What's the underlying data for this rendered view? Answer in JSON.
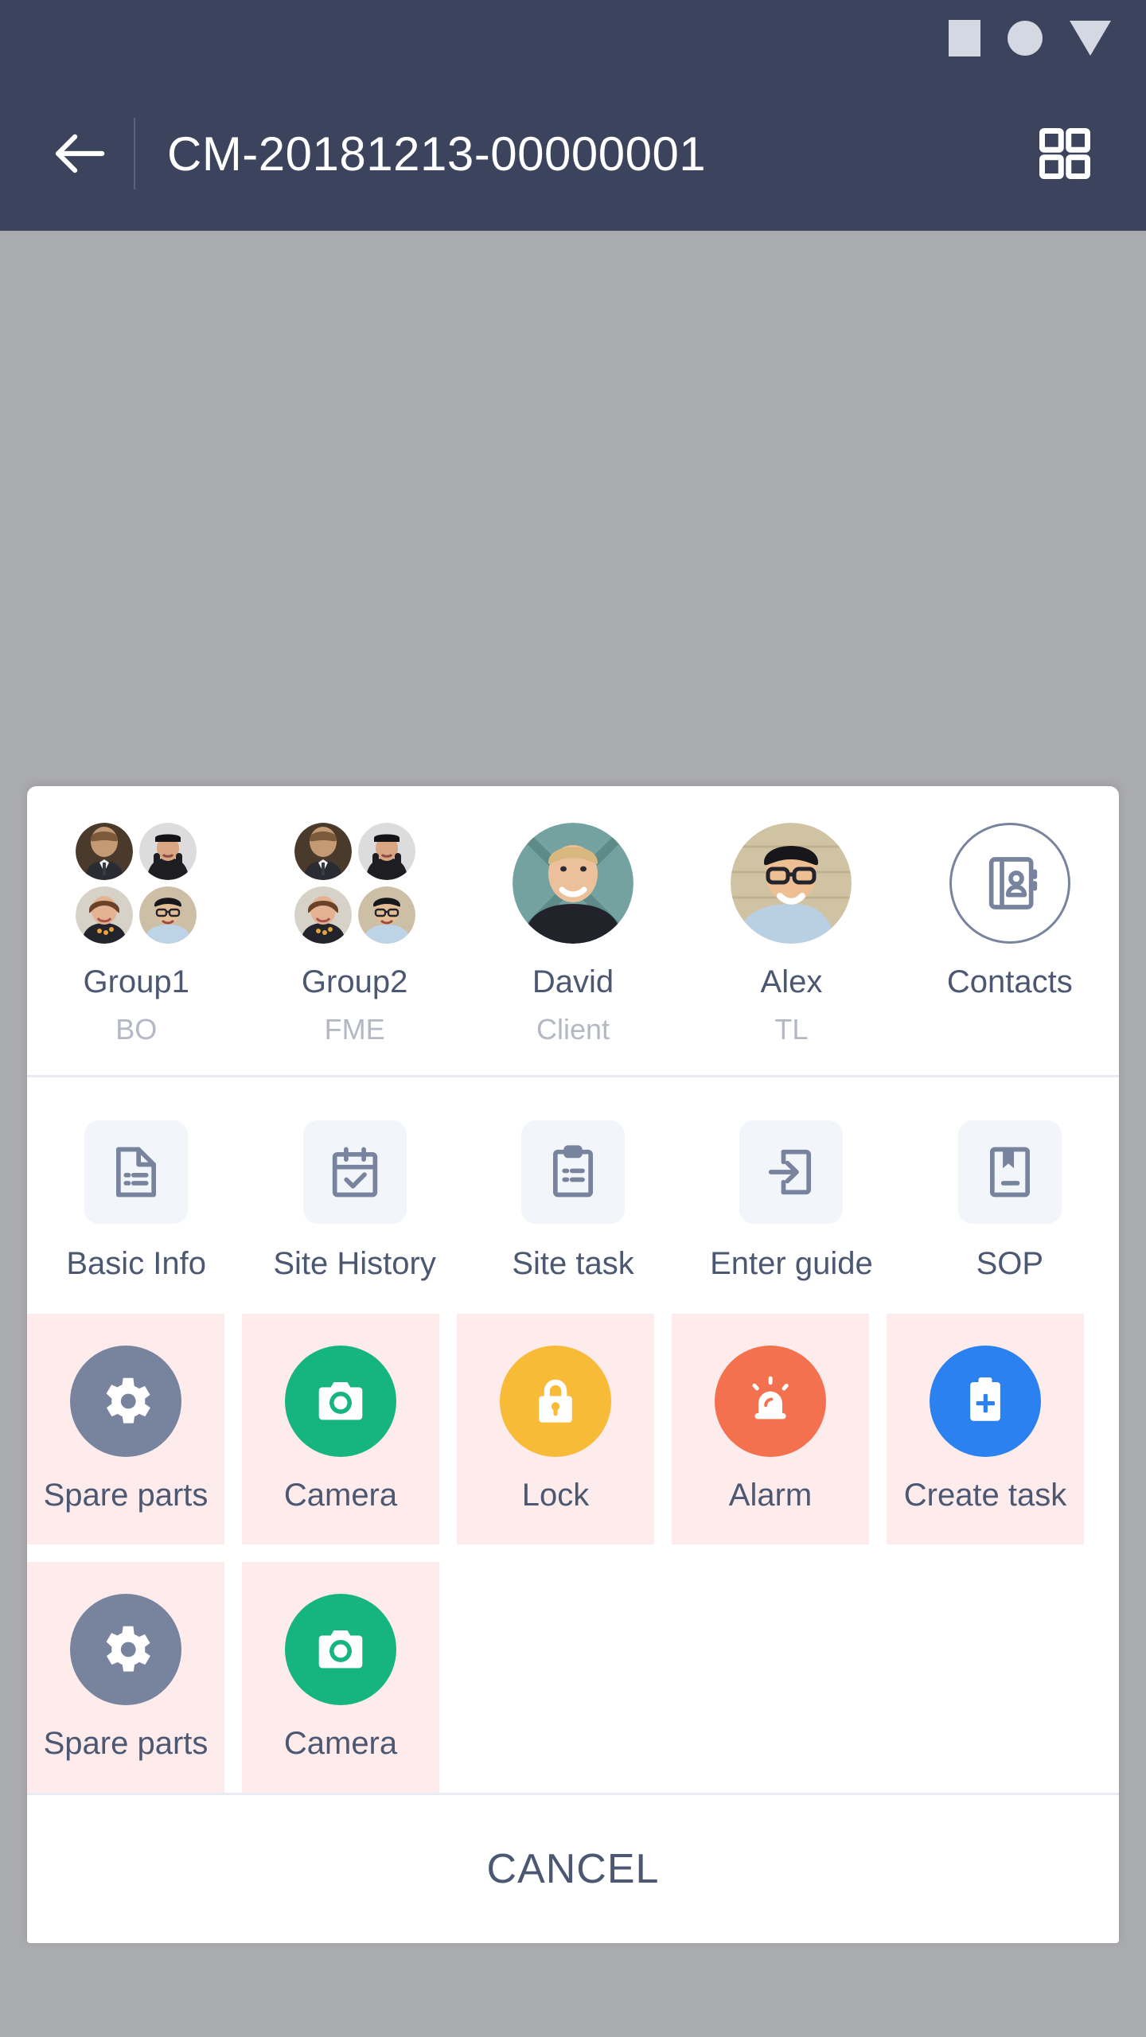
{
  "statusbar": {
    "icons": [
      "square-placeholder-icon",
      "circle-placeholder-icon",
      "triangle-placeholder-icon"
    ],
    "color": "#d3d8e3"
  },
  "appbar": {
    "back_icon": "back-arrow-icon",
    "title": "CM-20181213-00000001",
    "grid_icon": "grid-menu-icon",
    "background": "#3b445c",
    "title_color": "#ffffff"
  },
  "backdrop": {
    "color": "#aaabaf"
  },
  "sheet": {
    "contacts": [
      {
        "name": "Group1",
        "role": "BO",
        "avatar": "group-avatars"
      },
      {
        "name": "Group2",
        "role": "FME",
        "avatar": "group-avatars"
      },
      {
        "name": "David",
        "role": "Client",
        "avatar": "person-photo"
      },
      {
        "name": "Alex",
        "role": "TL",
        "avatar": "person-photo"
      },
      {
        "name": "Contacts",
        "role": "",
        "avatar": "address-book-icon"
      }
    ],
    "tools": [
      {
        "label": "Basic Info",
        "icon": "document-lines-icon"
      },
      {
        "label": "Site History",
        "icon": "calendar-check-icon"
      },
      {
        "label": "Site task",
        "icon": "clipboard-lines-icon"
      },
      {
        "label": "Enter guide",
        "icon": "login-arrow-icon"
      },
      {
        "label": "SOP",
        "icon": "bookmark-book-icon"
      }
    ],
    "actions": [
      {
        "label": "Spare parts",
        "icon": "gear-icon",
        "color": "#78849e"
      },
      {
        "label": "Camera",
        "icon": "camera-icon",
        "color": "#16b57f"
      },
      {
        "label": "Lock",
        "icon": "padlock-icon",
        "color": "#f7bb38"
      },
      {
        "label": "Alarm",
        "icon": "alarm-siren-icon",
        "color": "#f4714f"
      },
      {
        "label": "Create task",
        "icon": "clipboard-plus-icon",
        "color": "#2b81f0"
      },
      {
        "label": "Spare parts",
        "icon": "gear-icon",
        "color": "#78849e"
      },
      {
        "label": "Camera",
        "icon": "camera-icon",
        "color": "#16b57f"
      }
    ],
    "action_cell_background": "#fdeceb",
    "tool_tile_background": "#f2f5fa",
    "icon_stroke_color": "#78849e",
    "label_color": "#4c5771",
    "role_color": "#b3b8c4",
    "cancel_label": "CANCEL"
  }
}
